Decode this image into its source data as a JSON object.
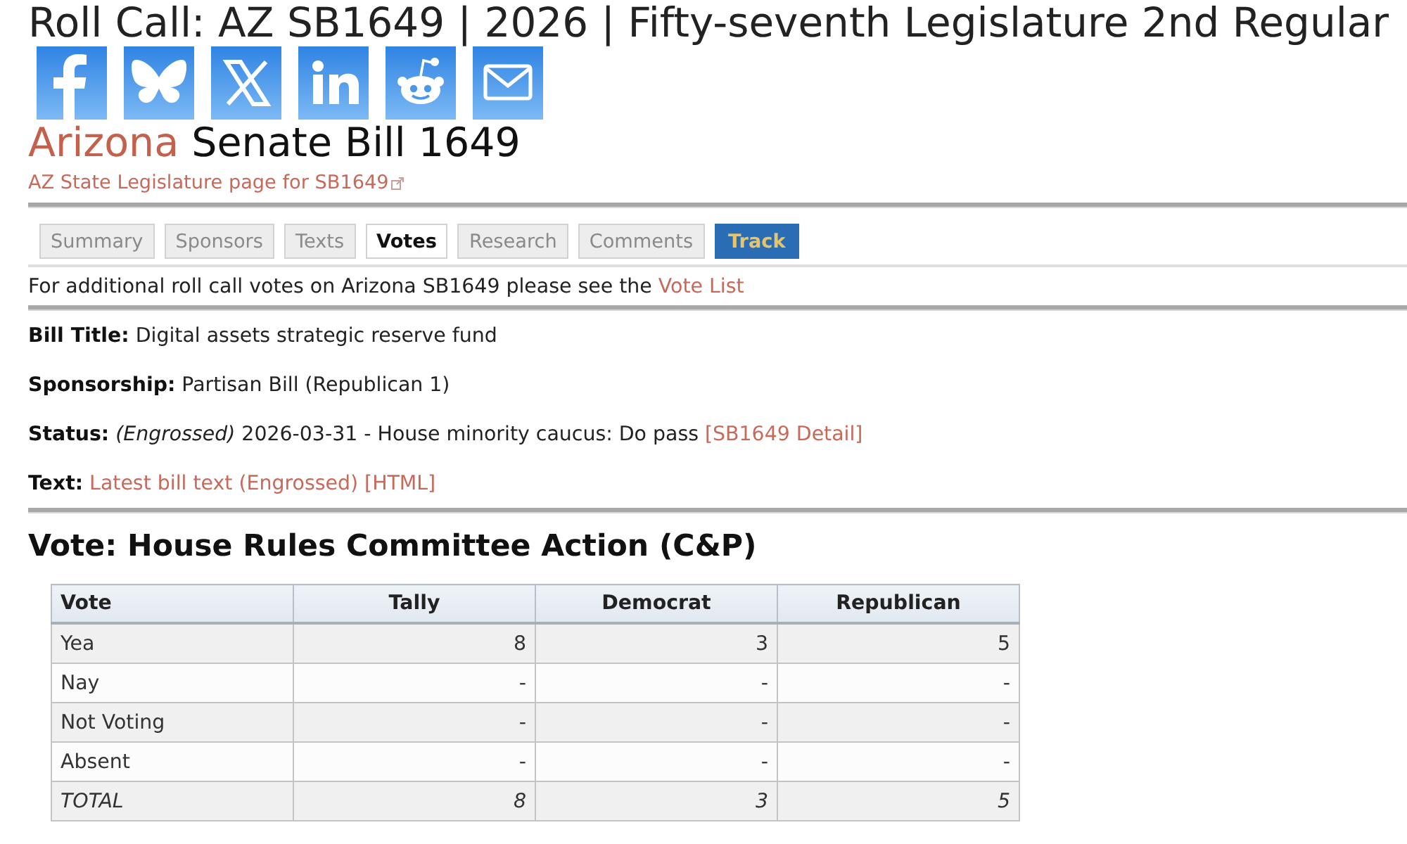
{
  "page_title": "Roll Call: AZ SB1649 | 2026 | Fifty-seventh Legislature 2nd Regular",
  "heading": {
    "state": "Arizona",
    "title": "Senate Bill 1649"
  },
  "legislature_link": "AZ State Legislature page for SB1649",
  "tabs": [
    {
      "label": "Summary",
      "kind": "tab",
      "selected": false
    },
    {
      "label": "Sponsors",
      "kind": "tab",
      "selected": false
    },
    {
      "label": "Texts",
      "kind": "tab",
      "selected": false
    },
    {
      "label": "Votes",
      "kind": "tab",
      "selected": true
    },
    {
      "label": "Research",
      "kind": "tab",
      "selected": false
    },
    {
      "label": "Comments",
      "kind": "tab",
      "selected": false
    },
    {
      "label": "Track",
      "kind": "action",
      "selected": false
    }
  ],
  "notice": {
    "text": "For additional roll call votes on Arizona SB1649 please see the",
    "link": "Vote List"
  },
  "details": [
    {
      "label": "Bill Title:",
      "text": "Digital assets strategic reserve fund"
    },
    {
      "label": "Sponsorship:",
      "text": "Partisan Bill (Republican 1)"
    },
    {
      "label": "Status:",
      "text": "*(Engrossed)* 2026-03-31 - House minority caucus: Do pass",
      "links": [
        "[SB1649 Detail]"
      ]
    },
    {
      "label": "Text:",
      "links": [
        "Latest bill text (Engrossed)",
        "[HTML]"
      ]
    }
  ],
  "vote": {
    "title": "Vote: House Rules Committee Action (C&P)",
    "table": {
      "columns": [
        "Vote",
        "Tally",
        "Democrat",
        "Republican"
      ],
      "rows": [
        {
          "kind": "count",
          "cells": [
            "Yea",
            "8",
            "3",
            "5"
          ]
        },
        {
          "kind": "count",
          "cells": [
            "Nay",
            "-",
            "-",
            "-"
          ]
        },
        {
          "kind": "count",
          "cells": [
            "Not Voting",
            "-",
            "-",
            "-"
          ]
        },
        {
          "kind": "count",
          "cells": [
            "Absent",
            "-",
            "-",
            "-"
          ]
        },
        {
          "kind": "total",
          "cells": [
            "TOTAL",
            "8",
            "3",
            "5"
          ]
        }
      ]
    }
  }
}
